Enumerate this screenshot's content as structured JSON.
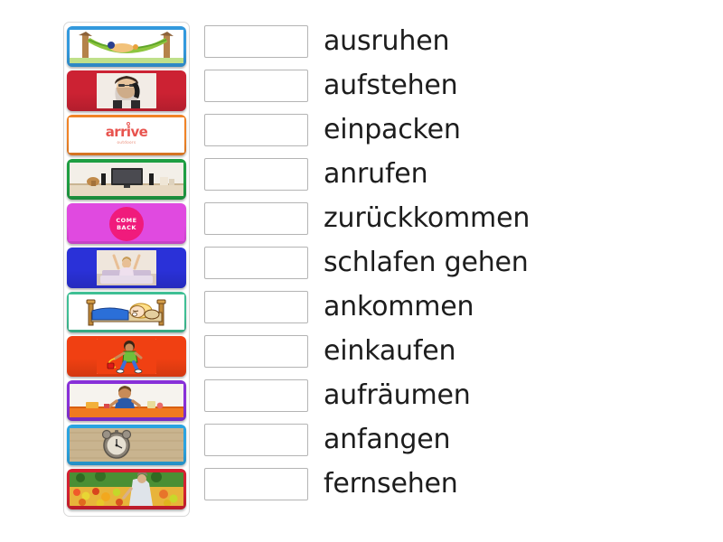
{
  "activity": {
    "type": "match-up",
    "tiles": [
      {
        "id": "tile-hammock",
        "icon_name": "hammock-rest-image",
        "tile_color": "#3399dd",
        "image_description": "Person resting in a green hammock between two trees",
        "thumb_style": "wide"
      },
      {
        "id": "tile-phone-call",
        "icon_name": "woman-on-telephone-image",
        "tile_color": "#cc2233",
        "image_description": "Woman with glasses talking on a telephone",
        "thumb_style": "narrow"
      },
      {
        "id": "tile-arrive",
        "icon_name": "arrive-logo-image",
        "tile_color": "#f08326",
        "image_description": "arrive logo wordmark on white",
        "thumb_style": "full",
        "logo_text": "arrive",
        "logo_subtext": "outdoors"
      },
      {
        "id": "tile-living-room-tv",
        "icon_name": "television-living-room-image",
        "tile_color": "#1e9e42",
        "image_description": "Living room with a flat screen television on a sideboard",
        "thumb_style": "wide"
      },
      {
        "id": "tile-come-back",
        "icon_name": "come-back-badge-image",
        "tile_color": "#e04ae0",
        "image_description": "Pink circular badge reading COME BACK",
        "thumb_style": "full",
        "badge_line1": "COME",
        "badge_line2": "BACK"
      },
      {
        "id": "tile-wake-up-stretch",
        "icon_name": "person-stretching-in-bed-image",
        "tile_color": "#2a31d8",
        "image_description": "Woman stretching arms up while sitting in bed",
        "thumb_style": "narrow"
      },
      {
        "id": "tile-sleeping-child",
        "icon_name": "sleeping-child-cartoon-image",
        "tile_color": "#3fbf94",
        "image_description": "Cartoon blond child asleep in a wooden bed with blue blanket",
        "thumb_style": "full"
      },
      {
        "id": "tile-child-running",
        "icon_name": "child-with-toy-running-image",
        "tile_color": "#f04012",
        "image_description": "Cartoon child running while pulling a toy",
        "thumb_style": "narrow"
      },
      {
        "id": "tile-child-tidying",
        "icon_name": "child-tidying-table-image",
        "tile_color": "#8830d8",
        "image_description": "Child in blue jumper tidying items on an orange table",
        "thumb_style": "wide"
      },
      {
        "id": "tile-alarm-clock",
        "icon_name": "alarm-clock-image",
        "tile_color": "#2aa3e0",
        "image_description": "Vintage alarm clock on a wooden surface",
        "thumb_style": "wide"
      },
      {
        "id": "tile-market-shopping",
        "icon_name": "market-vegetable-stall-image",
        "tile_color": "#d42030",
        "image_description": "Person shopping at a colourful vegetable market stall",
        "thumb_style": "wide"
      }
    ],
    "answers": [
      {
        "id": "answer-1",
        "label": "ausruhen",
        "drop_value": ""
      },
      {
        "id": "answer-2",
        "label": "aufstehen",
        "drop_value": ""
      },
      {
        "id": "answer-3",
        "label": "einpacken",
        "drop_value": ""
      },
      {
        "id": "answer-4",
        "label": "anrufen",
        "drop_value": ""
      },
      {
        "id": "answer-5",
        "label": "zurückkommen",
        "drop_value": ""
      },
      {
        "id": "answer-6",
        "label": "schlafen gehen",
        "drop_value": ""
      },
      {
        "id": "answer-7",
        "label": "ankommen",
        "drop_value": ""
      },
      {
        "id": "answer-8",
        "label": "einkaufen",
        "drop_value": ""
      },
      {
        "id": "answer-9",
        "label": "aufräumen",
        "drop_value": ""
      },
      {
        "id": "answer-10",
        "label": "anfangen",
        "drop_value": ""
      },
      {
        "id": "answer-11",
        "label": "fernsehen",
        "drop_value": ""
      }
    ]
  },
  "colors": {
    "page_background": "#ffffff",
    "panel_border": "#d8d8d8",
    "drop_box_border": "#b4b4b4",
    "label_text": "#1d1d1d"
  }
}
